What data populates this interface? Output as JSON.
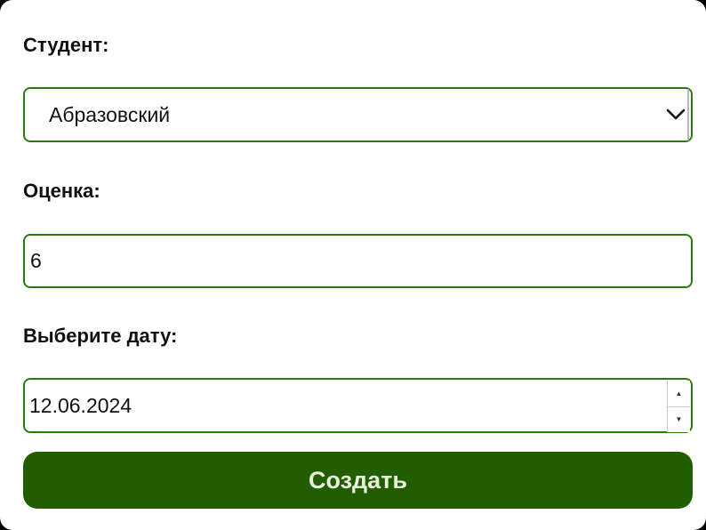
{
  "form": {
    "student_label": "Студент:",
    "student_value": "Абразовский",
    "grade_label": "Оценка:",
    "grade_value": "6",
    "date_label": "Выберите дату:",
    "date_value": "12.06.2024",
    "submit_label": "Создать"
  },
  "icons": {
    "select_chevron": "chevron-down-icon",
    "date_up": "caret-up-icon",
    "date_down": "caret-down-icon"
  },
  "colors": {
    "border": "#2a7a12",
    "button_bg": "#235d02",
    "button_text": "#e6f0da"
  }
}
